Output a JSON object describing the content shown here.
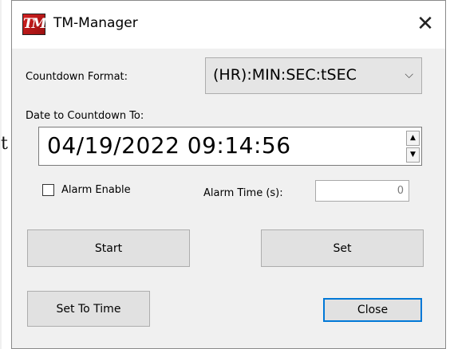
{
  "window": {
    "title": "TM-Manager",
    "logo_text": "TM",
    "close_glyph": "✕"
  },
  "background": {
    "partial_glyph": "t"
  },
  "countdown_format": {
    "label": "Countdown Format:",
    "selected": "(HR):MIN:SEC:tSEC",
    "arrow_icon": "chevron-down-icon",
    "arrow_glyph": "⌵"
  },
  "date": {
    "label": "Date to Countdown To:",
    "value": "04/19/2022 09:14:56",
    "spin_up": "▲",
    "spin_down": "▼"
  },
  "alarm": {
    "enable_label": "Alarm Enable",
    "enable_checked": false,
    "time_label": "Alarm Time (s):",
    "time_value": "0"
  },
  "buttons": {
    "start": "Start",
    "set": "Set",
    "set_to_time": "Set To Time",
    "close": "Close"
  },
  "colors": {
    "focus_border": "#0078d7",
    "logo": "#d32020"
  }
}
